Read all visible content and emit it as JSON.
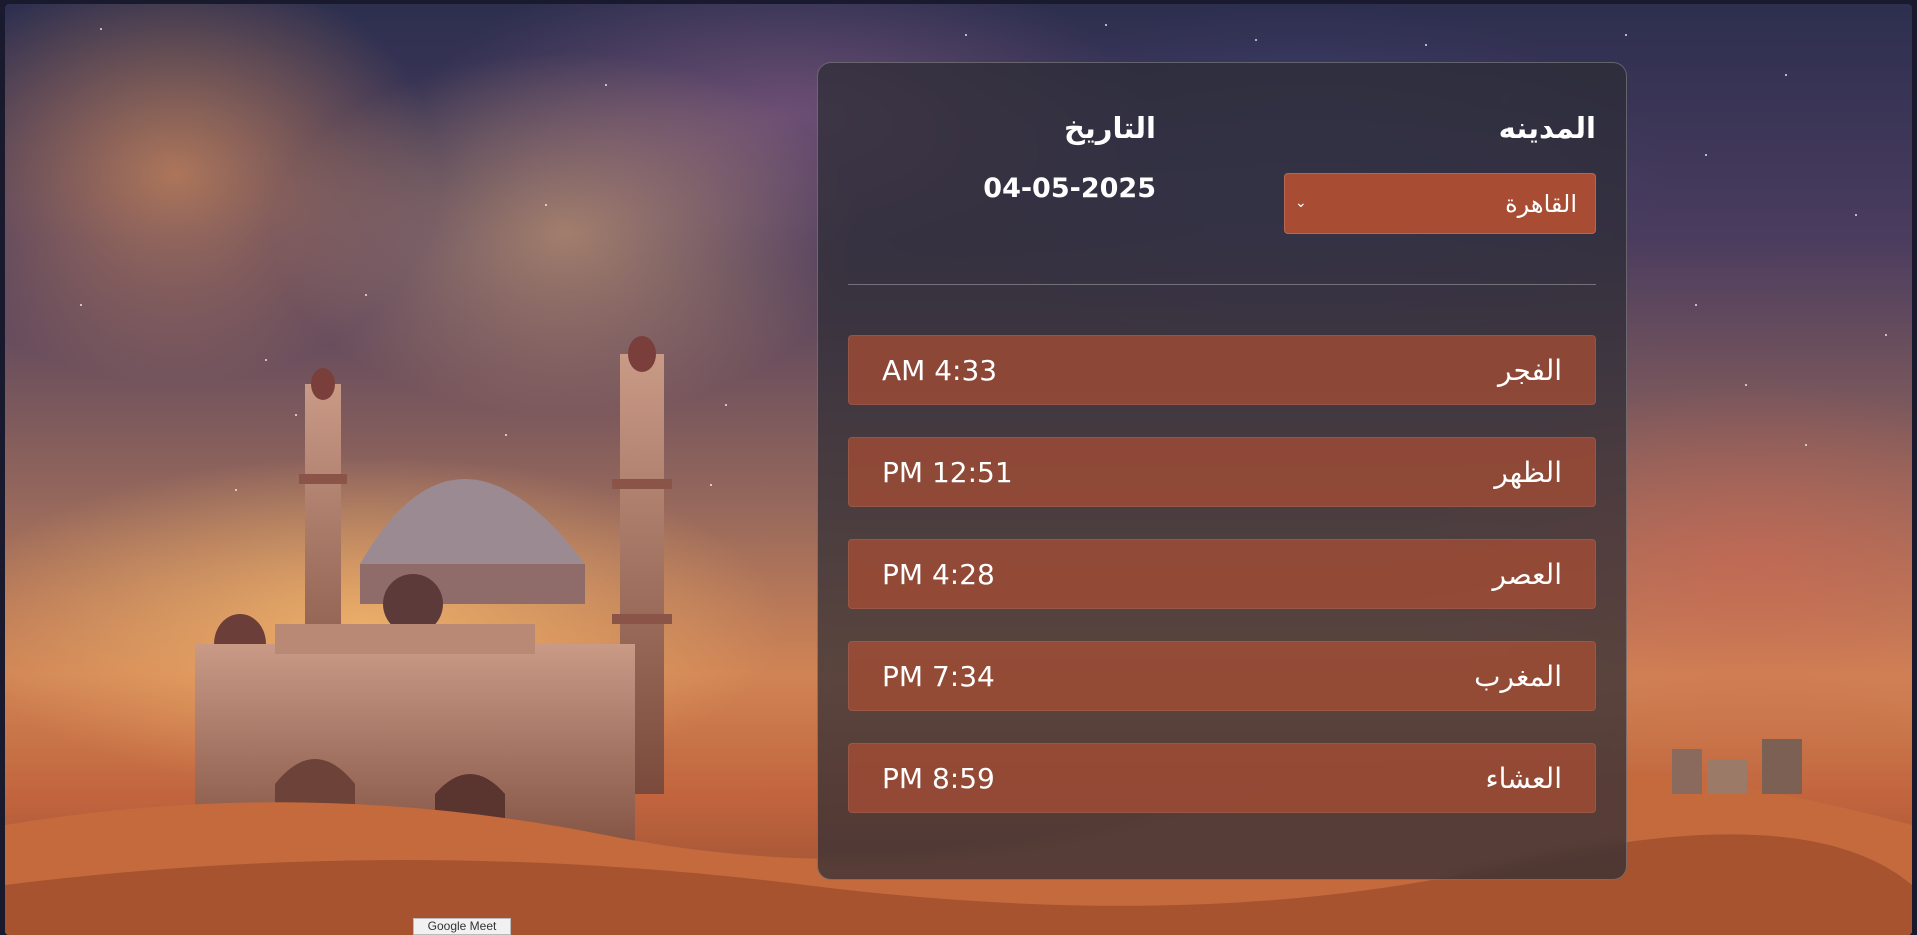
{
  "form": {
    "city_label": "المدينه",
    "date_label": "التاريخ",
    "city_selected": "القاهرة",
    "date_value": "04-05-2025"
  },
  "prayers": [
    {
      "name": "الفجر",
      "time": "AM 4:33"
    },
    {
      "name": "الظهر",
      "time": "PM 12:51"
    },
    {
      "name": "العصر",
      "time": "PM 4:28"
    },
    {
      "name": "المغرب",
      "time": "PM 7:34"
    },
    {
      "name": "العشاء",
      "time": "PM 8:59"
    }
  ],
  "tooltip": {
    "text": "Google Meet"
  },
  "colors": {
    "accent": "#a84d33",
    "card": "#2d2d34",
    "text": "#ffffff"
  }
}
